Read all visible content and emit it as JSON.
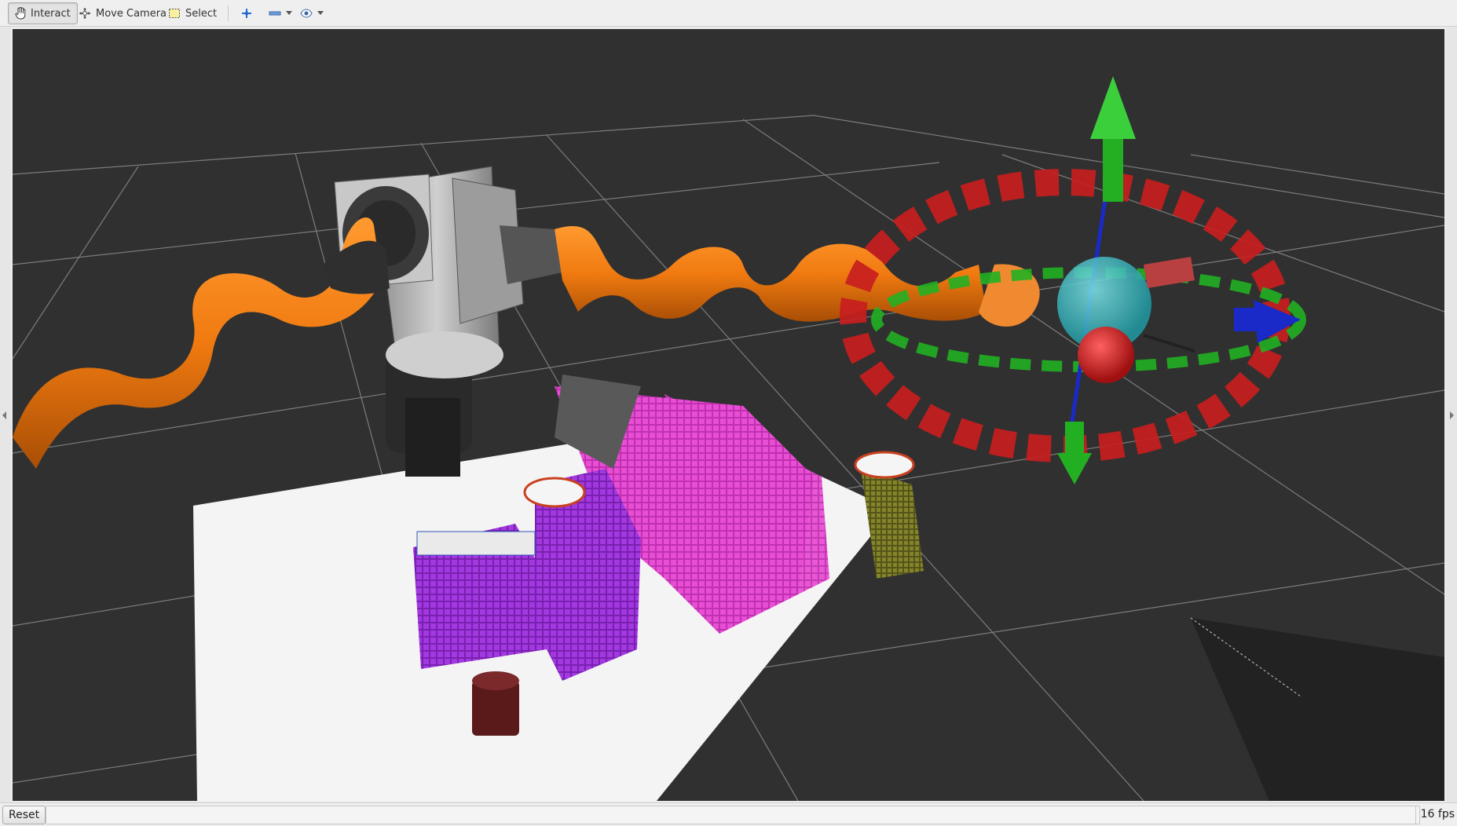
{
  "toolbar": {
    "interact_label": "Interact",
    "move_camera_label": "Move Camera",
    "select_label": "Select"
  },
  "status": {
    "reset_label": "Reset",
    "fps_text": "16 fps"
  },
  "icons": {
    "interact": "hand-pointer-icon",
    "move_camera": "camera-move-icon",
    "select": "select-rectangle-icon",
    "focus": "crosshair-plus-icon",
    "measure": "ruler-icon",
    "view": "eye-icon"
  },
  "colors": {
    "background": "#303030",
    "grid": "#8a8a8a",
    "robot_arm": "#f07a10",
    "robot_base": "#b8b8b8",
    "octomap_magenta": "#e040c8",
    "octomap_purple": "#9b30d8",
    "octomap_olive": "#7a7a20",
    "marker_ring": "#c81e1e",
    "marker_axis_green": "#22b022",
    "marker_axis_blue": "#1a2ac8",
    "end_effector_sphere": "#2fb8c0"
  }
}
